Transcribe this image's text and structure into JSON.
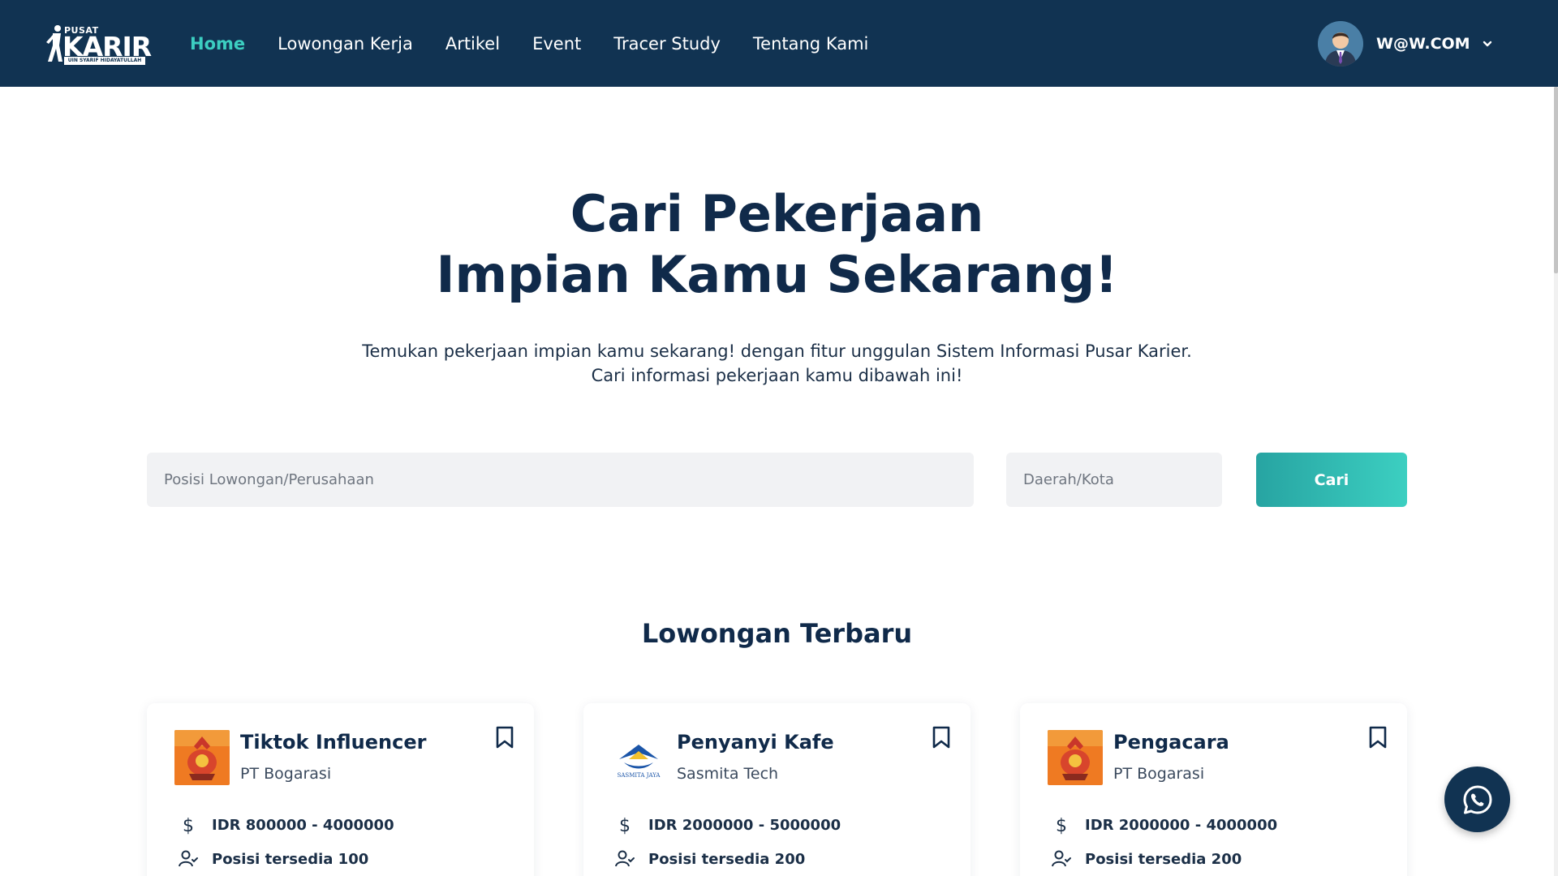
{
  "brand": {
    "top_text": "PUSAT",
    "name": "KARIR",
    "subtitle": "UIN SYARIF HIDAYATULLAH"
  },
  "nav": {
    "items": [
      {
        "label": "Home",
        "active": true
      },
      {
        "label": "Lowongan Kerja",
        "active": false
      },
      {
        "label": "Artikel",
        "active": false
      },
      {
        "label": "Event",
        "active": false
      },
      {
        "label": "Tracer Study",
        "active": false
      },
      {
        "label": "Tentang Kami",
        "active": false
      }
    ]
  },
  "user": {
    "name": "W@W.COM",
    "avatar_icon": "user-avatar",
    "menu_icon": "chevron-down-icon"
  },
  "hero": {
    "title_line1": "Cari Pekerjaan",
    "title_line2": "Impian Kamu Sekarang!",
    "subtitle_line1": "Temukan pekerjaan impian kamu sekarang! dengan fitur unggulan Sistem Informasi Pusar Karier.",
    "subtitle_line2": "Cari informasi pekerjaan kamu dibawah ini!"
  },
  "search": {
    "position_placeholder": "Posisi Lowongan/Perusahaan",
    "position_value": "",
    "city_placeholder": "Daerah/Kota",
    "city_value": "",
    "button_label": "Cari"
  },
  "section": {
    "title": "Lowongan Terbaru"
  },
  "jobs": [
    {
      "title": "Tiktok Influencer",
      "company": "PT Bogarasi",
      "salary": "IDR 800000 - 4000000",
      "positions": "Posisi tersedia 100",
      "logo": "bogarasi-logo"
    },
    {
      "title": "Penyanyi Kafe",
      "company": "Sasmita Tech",
      "salary": "IDR 2000000 - 5000000",
      "positions": "Posisi tersedia 200",
      "logo": "sasmita-logo",
      "logo_text": "SASMITA JAYA"
    },
    {
      "title": "Pengacara",
      "company": "PT Bogarasi",
      "salary": "IDR 2000000 - 4000000",
      "positions": "Posisi tersedia 200",
      "logo": "bogarasi-logo"
    }
  ],
  "icons": {
    "salary": "dollar-icon",
    "positions": "user-check-icon",
    "bookmark": "bookmark-icon",
    "whatsapp": "whatsapp-icon"
  },
  "colors": {
    "navbar": "#113352",
    "accent": "#3ccfc1",
    "button_start": "#27a4a2",
    "button_end": "#3ccfc1",
    "heading": "#102a4a"
  }
}
